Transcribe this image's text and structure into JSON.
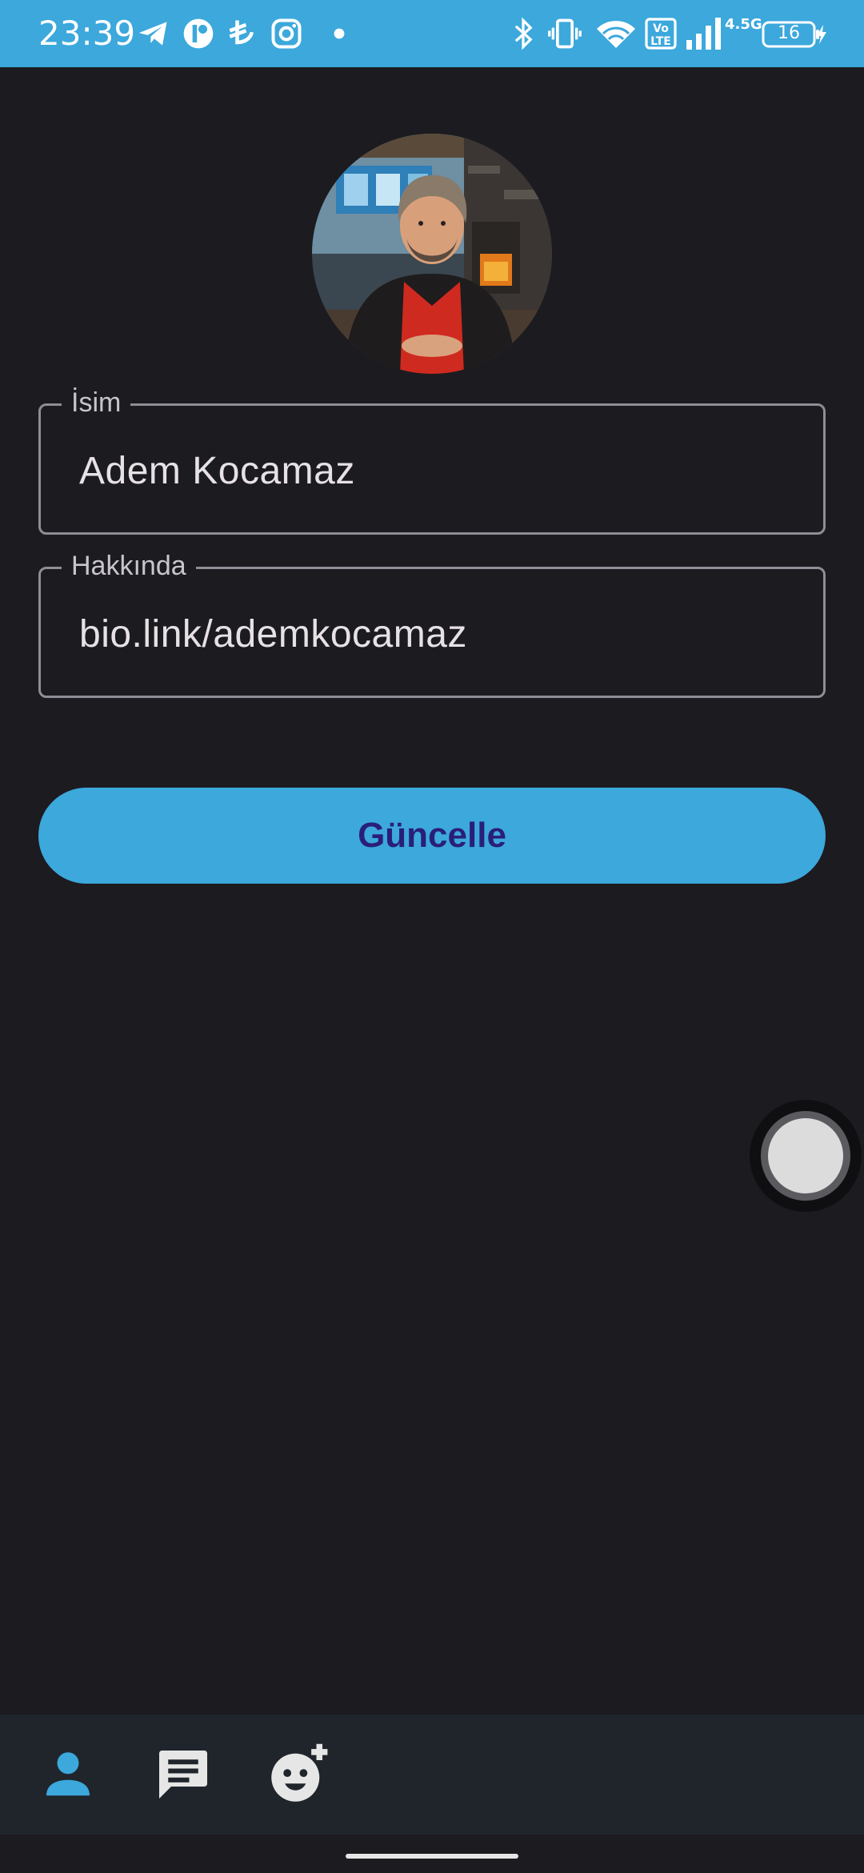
{
  "status_bar": {
    "time": "23:39",
    "network": "4.5G",
    "volte": "Vo LTE",
    "battery": "16",
    "icons_left": [
      "telegram-icon",
      "app-icon",
      "lira-icon",
      "instagram-icon",
      "dot-icon"
    ],
    "icons_right": [
      "bluetooth-icon",
      "vibrate-icon",
      "wifi-icon",
      "volte-icon",
      "signal-icon",
      "battery-icon",
      "charging-icon"
    ]
  },
  "profile": {
    "avatar": "profile-photo"
  },
  "form": {
    "name_label": "İsim",
    "name_value": "Adem Kocamaz",
    "about_label": "Hakkında",
    "about_value": "bio.link/ademkocamaz",
    "update_button": "Güncelle"
  },
  "bottom_nav": {
    "items": [
      {
        "icon": "person-icon",
        "active": true
      },
      {
        "icon": "chat-icon",
        "active": false
      },
      {
        "icon": "add-face-icon",
        "active": false
      }
    ]
  },
  "colors": {
    "accent": "#3ca8dc",
    "background": "#1c1b20",
    "button_text": "#2a1f78",
    "nav_background": "#20252c"
  }
}
